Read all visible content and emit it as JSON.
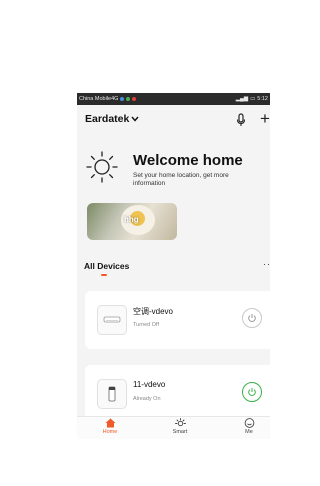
{
  "status_bar": {
    "carrier": "China Mobile4G",
    "right_text": "5:12"
  },
  "header": {
    "home_name": "Eardatek",
    "add_symbol": "+"
  },
  "welcome": {
    "title": "Welcome home",
    "subtitle": "Set your home location, get more information"
  },
  "scene": {
    "label": "hhg"
  },
  "devices": {
    "section_title": "All Devices",
    "more_symbol": "··",
    "items": [
      {
        "name": "空调-vdevo",
        "status": "Turned Off",
        "power": "off"
      },
      {
        "name": "11-vdevo",
        "status": "Already On",
        "power": "on"
      }
    ]
  },
  "tabs": [
    {
      "label": "Home",
      "active": true
    },
    {
      "label": "Smart",
      "active": false
    },
    {
      "label": "Me",
      "active": false
    }
  ],
  "colors": {
    "accent": "#f05a28",
    "on": "#3cb14a",
    "off": "#c9c9c9"
  }
}
